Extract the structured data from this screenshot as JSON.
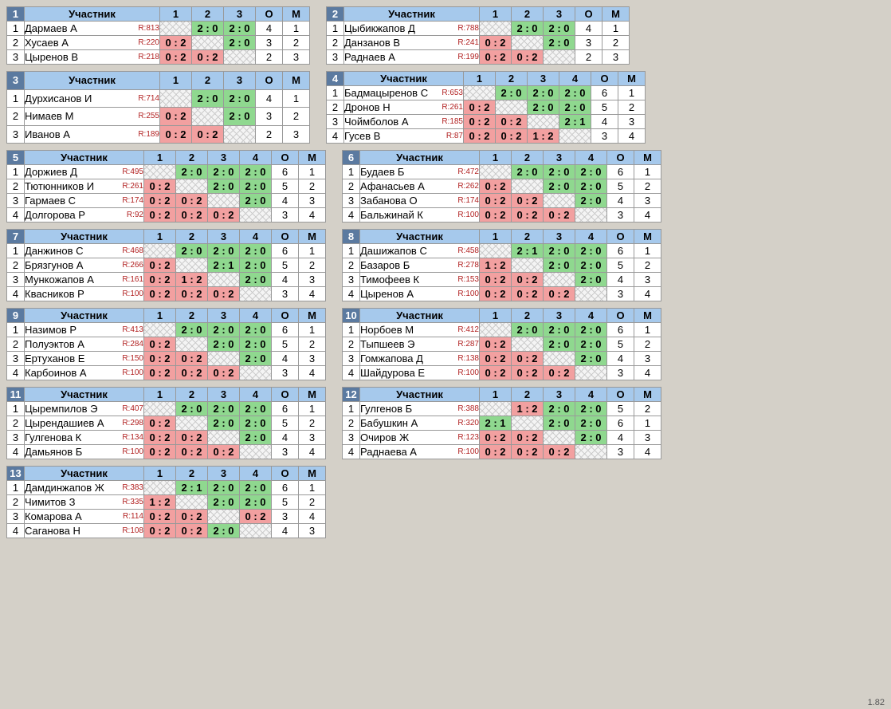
{
  "labels": {
    "participant": "Участник",
    "o": "О",
    "m": "М"
  },
  "version": "1.82",
  "groups": [
    {
      "num": "1",
      "rounds": 3,
      "players": [
        {
          "n": "1",
          "name": "Дармаев А",
          "r": "R:813",
          "cells": [
            "diag",
            "2 : 0",
            "2 : 0"
          ],
          "o": "4",
          "m": "1"
        },
        {
          "n": "2",
          "name": "Хусаев А",
          "r": "R:220",
          "cells": [
            "0 : 2",
            "diag",
            "2 : 0"
          ],
          "o": "3",
          "m": "2"
        },
        {
          "n": "3",
          "name": "Цыренов В",
          "r": "R:218",
          "cells": [
            "0 : 2",
            "0 : 2",
            "diag"
          ],
          "o": "2",
          "m": "3"
        }
      ]
    },
    {
      "num": "2",
      "rounds": 3,
      "players": [
        {
          "n": "1",
          "name": "Цыбикжапов Д",
          "r": "R:788",
          "cells": [
            "diag",
            "2 : 0",
            "2 : 0"
          ],
          "o": "4",
          "m": "1"
        },
        {
          "n": "2",
          "name": "Данзанов В",
          "r": "R:241",
          "cells": [
            "0 : 2",
            "diag",
            "2 : 0"
          ],
          "o": "3",
          "m": "2"
        },
        {
          "n": "3",
          "name": "Раднаев А",
          "r": "R:199",
          "cells": [
            "0 : 2",
            "0 : 2",
            "diag"
          ],
          "o": "2",
          "m": "3"
        }
      ]
    },
    {
      "num": "3",
      "rounds": 3,
      "players": [
        {
          "n": "1",
          "name": "Дурхисанов И",
          "r": "R:714",
          "cells": [
            "diag",
            "2 : 0",
            "2 : 0"
          ],
          "o": "4",
          "m": "1"
        },
        {
          "n": "2",
          "name": "Нимаев М",
          "r": "R:255",
          "cells": [
            "0 : 2",
            "diag",
            "2 : 0"
          ],
          "o": "3",
          "m": "2"
        },
        {
          "n": "3",
          "name": "Иванов А",
          "r": "R:189",
          "cells": [
            "0 : 2",
            "0 : 2",
            "diag"
          ],
          "o": "2",
          "m": "3"
        }
      ]
    },
    {
      "num": "4",
      "rounds": 4,
      "players": [
        {
          "n": "1",
          "name": "Бадмацыренов С",
          "r": "R:653",
          "cells": [
            "diag",
            "2 : 0",
            "2 : 0",
            "2 : 0"
          ],
          "o": "6",
          "m": "1"
        },
        {
          "n": "2",
          "name": "Дронов Н",
          "r": "R:261",
          "cells": [
            "0 : 2",
            "diag",
            "2 : 0",
            "2 : 0"
          ],
          "o": "5",
          "m": "2"
        },
        {
          "n": "3",
          "name": "Чоймболов А",
          "r": "R:185",
          "cells": [
            "0 : 2",
            "0 : 2",
            "diag",
            "2 : 1"
          ],
          "o": "4",
          "m": "3"
        },
        {
          "n": "4",
          "name": "Гусев В",
          "r": "R:87",
          "cells": [
            "0 : 2",
            "0 : 2",
            "1 : 2",
            "diag"
          ],
          "o": "3",
          "m": "4"
        }
      ]
    },
    {
      "num": "5",
      "rounds": 4,
      "players": [
        {
          "n": "1",
          "name": "Доржиев Д",
          "r": "R:495",
          "cells": [
            "diag",
            "2 : 0",
            "2 : 0",
            "2 : 0"
          ],
          "o": "6",
          "m": "1"
        },
        {
          "n": "2",
          "name": "Тютюнников И",
          "r": "R:261",
          "cells": [
            "0 : 2",
            "diag",
            "2 : 0",
            "2 : 0"
          ],
          "o": "5",
          "m": "2"
        },
        {
          "n": "3",
          "name": "Гармаев С",
          "r": "R:174",
          "cells": [
            "0 : 2",
            "0 : 2",
            "diag",
            "2 : 0"
          ],
          "o": "4",
          "m": "3"
        },
        {
          "n": "4",
          "name": "Долгорова Р",
          "r": "R:92",
          "cells": [
            "0 : 2",
            "0 : 2",
            "0 : 2",
            "diag"
          ],
          "o": "3",
          "m": "4"
        }
      ]
    },
    {
      "num": "6",
      "rounds": 4,
      "players": [
        {
          "n": "1",
          "name": "Будаев Б",
          "r": "R:472",
          "cells": [
            "diag",
            "2 : 0",
            "2 : 0",
            "2 : 0"
          ],
          "o": "6",
          "m": "1"
        },
        {
          "n": "2",
          "name": "Афанасьев А",
          "r": "R:262",
          "cells": [
            "0 : 2",
            "diag",
            "2 : 0",
            "2 : 0"
          ],
          "o": "5",
          "m": "2"
        },
        {
          "n": "3",
          "name": "Забанова О",
          "r": "R:174",
          "cells": [
            "0 : 2",
            "0 : 2",
            "diag",
            "2 : 0"
          ],
          "o": "4",
          "m": "3"
        },
        {
          "n": "4",
          "name": "Бальжинай К",
          "r": "R:100",
          "cells": [
            "0 : 2",
            "0 : 2",
            "0 : 2",
            "diag"
          ],
          "o": "3",
          "m": "4"
        }
      ]
    },
    {
      "num": "7",
      "rounds": 4,
      "players": [
        {
          "n": "1",
          "name": "Данжинов С",
          "r": "R:468",
          "cells": [
            "diag",
            "2 : 0",
            "2 : 0",
            "2 : 0"
          ],
          "o": "6",
          "m": "1"
        },
        {
          "n": "2",
          "name": "Брязгунов А",
          "r": "R:266",
          "cells": [
            "0 : 2",
            "diag",
            "2 : 1",
            "2 : 0"
          ],
          "o": "5",
          "m": "2"
        },
        {
          "n": "3",
          "name": "Мункожапов А",
          "r": "R:161",
          "cells": [
            "0 : 2",
            "1 : 2",
            "diag",
            "2 : 0"
          ],
          "o": "4",
          "m": "3"
        },
        {
          "n": "4",
          "name": "Квасников Р",
          "r": "R:100",
          "cells": [
            "0 : 2",
            "0 : 2",
            "0 : 2",
            "diag"
          ],
          "o": "3",
          "m": "4"
        }
      ]
    },
    {
      "num": "8",
      "rounds": 4,
      "players": [
        {
          "n": "1",
          "name": "Дашижапов С",
          "r": "R:458",
          "cells": [
            "diag",
            "2 : 1",
            "2 : 0",
            "2 : 0"
          ],
          "o": "6",
          "m": "1"
        },
        {
          "n": "2",
          "name": "Базаров Б",
          "r": "R:278",
          "cells": [
            "1 : 2",
            "diag",
            "2 : 0",
            "2 : 0"
          ],
          "o": "5",
          "m": "2"
        },
        {
          "n": "3",
          "name": "Тимофеев К",
          "r": "R:153",
          "cells": [
            "0 : 2",
            "0 : 2",
            "diag",
            "2 : 0"
          ],
          "o": "4",
          "m": "3"
        },
        {
          "n": "4",
          "name": "Цыренов А",
          "r": "R:100",
          "cells": [
            "0 : 2",
            "0 : 2",
            "0 : 2",
            "diag"
          ],
          "o": "3",
          "m": "4"
        }
      ]
    },
    {
      "num": "9",
      "rounds": 4,
      "players": [
        {
          "n": "1",
          "name": "Назимов Р",
          "r": "R:413",
          "cells": [
            "diag",
            "2 : 0",
            "2 : 0",
            "2 : 0"
          ],
          "o": "6",
          "m": "1"
        },
        {
          "n": "2",
          "name": "Полуэктов А",
          "r": "R:284",
          "cells": [
            "0 : 2",
            "diag",
            "2 : 0",
            "2 : 0"
          ],
          "o": "5",
          "m": "2"
        },
        {
          "n": "3",
          "name": "Ертуханов Е",
          "r": "R:150",
          "cells": [
            "0 : 2",
            "0 : 2",
            "diag",
            "2 : 0"
          ],
          "o": "4",
          "m": "3"
        },
        {
          "n": "4",
          "name": "Карбоинов А",
          "r": "R:100",
          "cells": [
            "0 : 2",
            "0 : 2",
            "0 : 2",
            "diag"
          ],
          "o": "3",
          "m": "4"
        }
      ]
    },
    {
      "num": "10",
      "rounds": 4,
      "players": [
        {
          "n": "1",
          "name": "Норбоев М",
          "r": "R:412",
          "cells": [
            "diag",
            "2 : 0",
            "2 : 0",
            "2 : 0"
          ],
          "o": "6",
          "m": "1"
        },
        {
          "n": "2",
          "name": "Тыпшеев Э",
          "r": "R:287",
          "cells": [
            "0 : 2",
            "diag",
            "2 : 0",
            "2 : 0"
          ],
          "o": "5",
          "m": "2"
        },
        {
          "n": "3",
          "name": "Гомжапова Д",
          "r": "R:138",
          "cells": [
            "0 : 2",
            "0 : 2",
            "diag",
            "2 : 0"
          ],
          "o": "4",
          "m": "3"
        },
        {
          "n": "4",
          "name": "Шайдурова Е",
          "r": "R:100",
          "cells": [
            "0 : 2",
            "0 : 2",
            "0 : 2",
            "diag"
          ],
          "o": "3",
          "m": "4"
        }
      ]
    },
    {
      "num": "11",
      "rounds": 4,
      "players": [
        {
          "n": "1",
          "name": "Цыремпилов Э",
          "r": "R:407",
          "cells": [
            "diag",
            "2 : 0",
            "2 : 0",
            "2 : 0"
          ],
          "o": "6",
          "m": "1"
        },
        {
          "n": "2",
          "name": "Цырендашиев А",
          "r": "R:298",
          "cells": [
            "0 : 2",
            "diag",
            "2 : 0",
            "2 : 0"
          ],
          "o": "5",
          "m": "2"
        },
        {
          "n": "3",
          "name": "Гулгенова К",
          "r": "R:134",
          "cells": [
            "0 : 2",
            "0 : 2",
            "diag",
            "2 : 0"
          ],
          "o": "4",
          "m": "3"
        },
        {
          "n": "4",
          "name": "Дамьянов Б",
          "r": "R:100",
          "cells": [
            "0 : 2",
            "0 : 2",
            "0 : 2",
            "diag"
          ],
          "o": "3",
          "m": "4"
        }
      ]
    },
    {
      "num": "12",
      "rounds": 4,
      "players": [
        {
          "n": "1",
          "name": "Гулгенов Б",
          "r": "R:388",
          "cells": [
            "diag",
            "1 : 2",
            "2 : 0",
            "2 : 0"
          ],
          "o": "5",
          "m": "2"
        },
        {
          "n": "2",
          "name": "Бабушкин А",
          "r": "R:320",
          "cells": [
            "2 : 1",
            "diag",
            "2 : 0",
            "2 : 0"
          ],
          "o": "6",
          "m": "1"
        },
        {
          "n": "3",
          "name": "Очиров Ж",
          "r": "R:123",
          "cells": [
            "0 : 2",
            "0 : 2",
            "diag",
            "2 : 0"
          ],
          "o": "4",
          "m": "3"
        },
        {
          "n": "4",
          "name": "Раднаева А",
          "r": "R:100",
          "cells": [
            "0 : 2",
            "0 : 2",
            "0 : 2",
            "diag"
          ],
          "o": "3",
          "m": "4"
        }
      ]
    },
    {
      "num": "13",
      "rounds": 4,
      "players": [
        {
          "n": "1",
          "name": "Дамдинжапов Ж",
          "r": "R:383",
          "cells": [
            "diag",
            "2 : 1",
            "2 : 0",
            "2 : 0"
          ],
          "o": "6",
          "m": "1"
        },
        {
          "n": "2",
          "name": "Чимитов З",
          "r": "R:335",
          "cells": [
            "1 : 2",
            "diag",
            "2 : 0",
            "2 : 0"
          ],
          "o": "5",
          "m": "2"
        },
        {
          "n": "3",
          "name": "Комарова А",
          "r": "R:114",
          "cells": [
            "0 : 2",
            "0 : 2",
            "diag",
            "0 : 2"
          ],
          "o": "3",
          "m": "4"
        },
        {
          "n": "4",
          "name": "Саганова Н",
          "r": "R:108",
          "cells": [
            "0 : 2",
            "0 : 2",
            "2 : 0",
            "diag"
          ],
          "o": "4",
          "m": "3"
        }
      ]
    }
  ]
}
